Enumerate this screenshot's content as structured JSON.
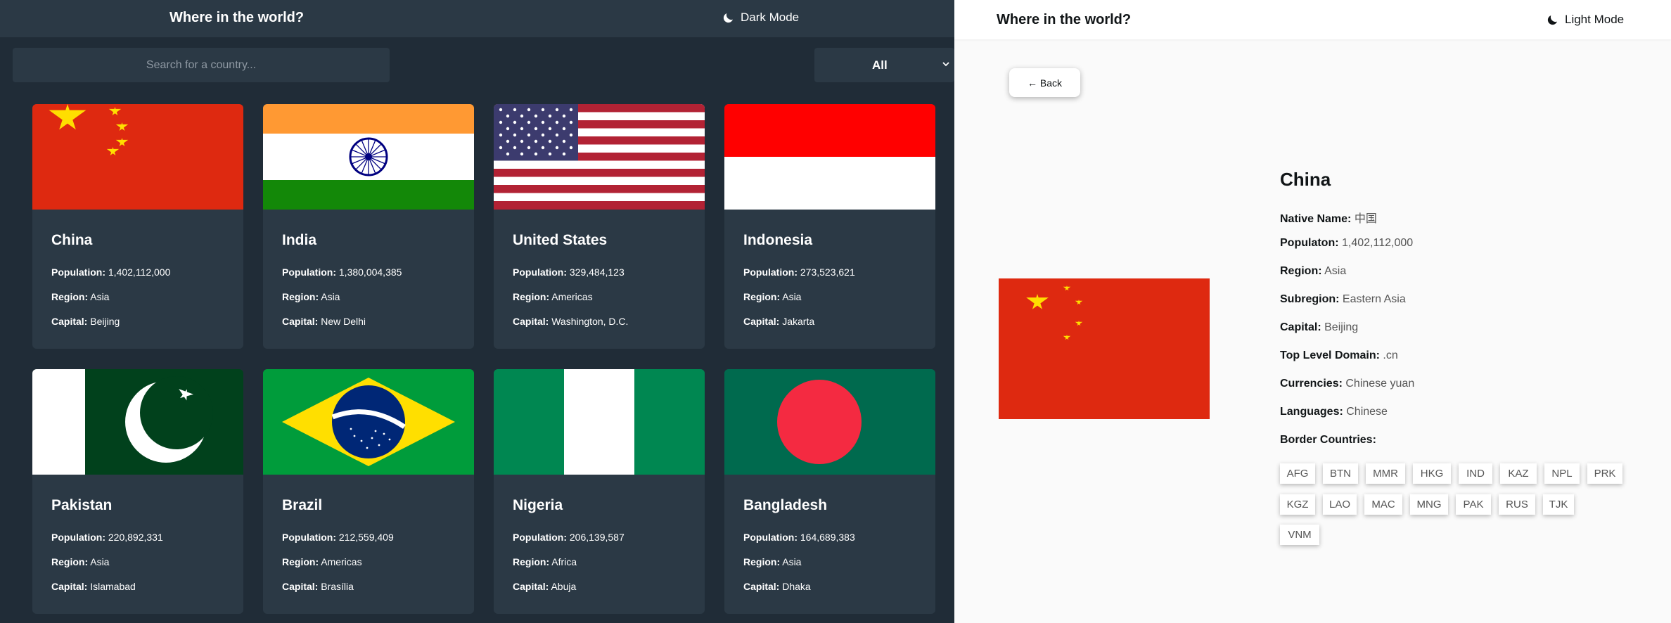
{
  "dark": {
    "title": "Where in the world?",
    "mode_label": "Dark Mode",
    "search_placeholder": "Search for a country...",
    "filter_value": "All",
    "labels": {
      "population": "Population:",
      "region": "Region:",
      "capital": "Capital:"
    },
    "countries": [
      {
        "name": "China",
        "population": "1,402,112,000",
        "region": "Asia",
        "capital": "Beijing",
        "flag_icon": "china-flag"
      },
      {
        "name": "India",
        "population": "1,380,004,385",
        "region": "Asia",
        "capital": "New Delhi",
        "flag_icon": "india-flag"
      },
      {
        "name": "United States",
        "population": "329,484,123",
        "region": "Americas",
        "capital": "Washington, D.C.",
        "flag_icon": "usa-flag"
      },
      {
        "name": "Indonesia",
        "population": "273,523,621",
        "region": "Asia",
        "capital": "Jakarta",
        "flag_icon": "indonesia-flag"
      },
      {
        "name": "Pakistan",
        "population": "220,892,331",
        "region": "Asia",
        "capital": "Islamabad",
        "flag_icon": "pakistan-flag"
      },
      {
        "name": "Brazil",
        "population": "212,559,409",
        "region": "Americas",
        "capital": "Brasília",
        "flag_icon": "brazil-flag"
      },
      {
        "name": "Nigeria",
        "population": "206,139,587",
        "region": "Africa",
        "capital": "Abuja",
        "flag_icon": "nigeria-flag"
      },
      {
        "name": "Bangladesh",
        "population": "164,689,383",
        "region": "Asia",
        "capital": "Dhaka",
        "flag_icon": "bangladesh-flag"
      }
    ]
  },
  "light": {
    "title": "Where in the world?",
    "mode_label": "Light Mode",
    "back_label": "← Back",
    "country": {
      "name": "China",
      "native_name_label": "Native Name:",
      "native_name": "中国",
      "population_label": "Populaton:",
      "population": "1,402,112,000",
      "region_label": "Region:",
      "region": "Asia",
      "subregion_label": "Subregion:",
      "subregion": "Eastern Asia",
      "capital_label": "Capital:",
      "capital": "Beijing",
      "tld_label": "Top Level Domain:",
      "tld": ".cn",
      "currencies_label": "Currencies:",
      "currencies": "Chinese yuan",
      "languages_label": "Languages:",
      "languages": "Chinese",
      "borders_label": "Border Countries:",
      "borders": [
        "AFG",
        "BTN",
        "MMR",
        "HKG",
        "IND",
        "KAZ",
        "NPL",
        "PRK",
        "KGZ",
        "LAO",
        "MAC",
        "MNG",
        "PAK",
        "RUS",
        "TJK",
        "VNM"
      ]
    }
  },
  "colors": {
    "dark_bg": "#202c37",
    "dark_element": "#2b3945",
    "light_bg": "#fafafa",
    "light_text": "#111517"
  }
}
